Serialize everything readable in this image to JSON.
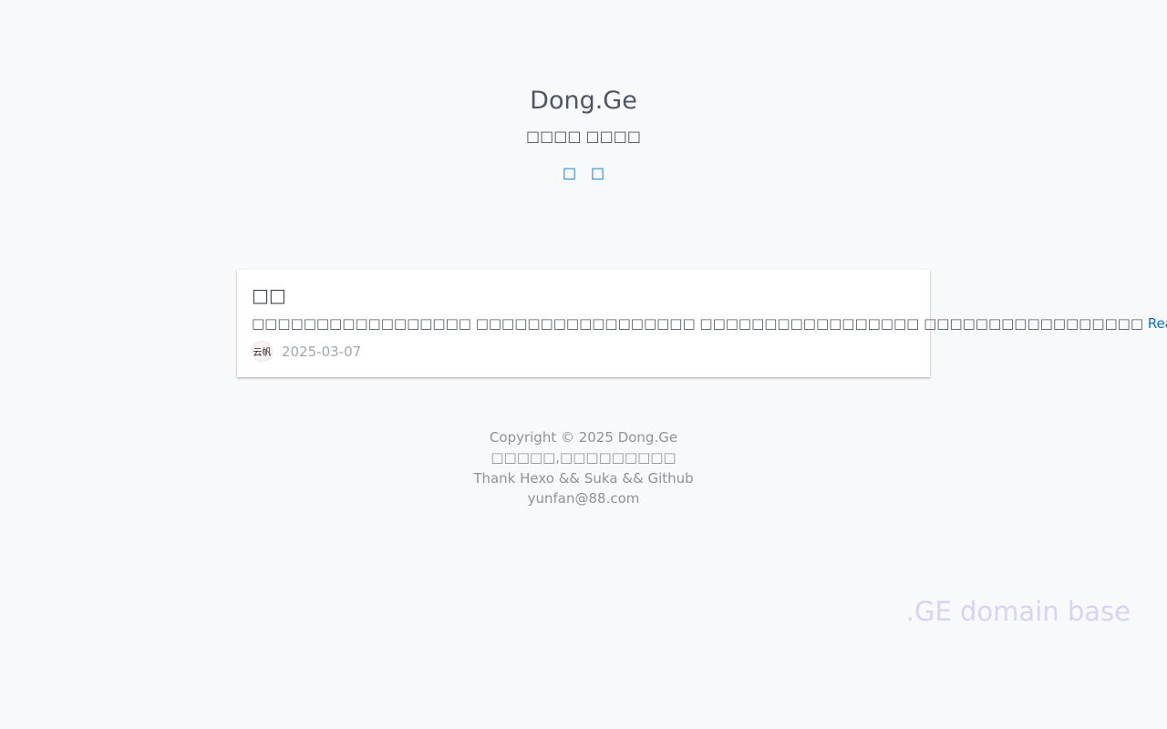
{
  "header": {
    "title": "Dong.Ge",
    "subtitle": "□□□□ □□□□",
    "social": [
      {
        "icon": "github-icon",
        "glyph": "□"
      },
      {
        "icon": "email-icon",
        "glyph": "□"
      }
    ]
  },
  "post": {
    "title": "□□",
    "excerpt": "□□□□□□□□□□□□□□□□□ □□□□□□□□□□□□□□□□□ □□□□□□□□□□□□□□□□□ □□□□□□□□□□□□□□□□□",
    "read_more": "Read More",
    "avatar_text": "云帆",
    "date": "2025-03-07"
  },
  "footer": {
    "copyright": "Copyright © 2025 Dong.Ge",
    "motto": "□□□□□,□□□□□□□□□",
    "thanks": "Thank Hexo && Suka && Github",
    "email": "yunfan@88.com"
  },
  "watermark": ".GE domain base",
  "colors": {
    "accent": "#0073d1",
    "background": "#f8f9fb",
    "watermark": "#d9d2f3"
  }
}
